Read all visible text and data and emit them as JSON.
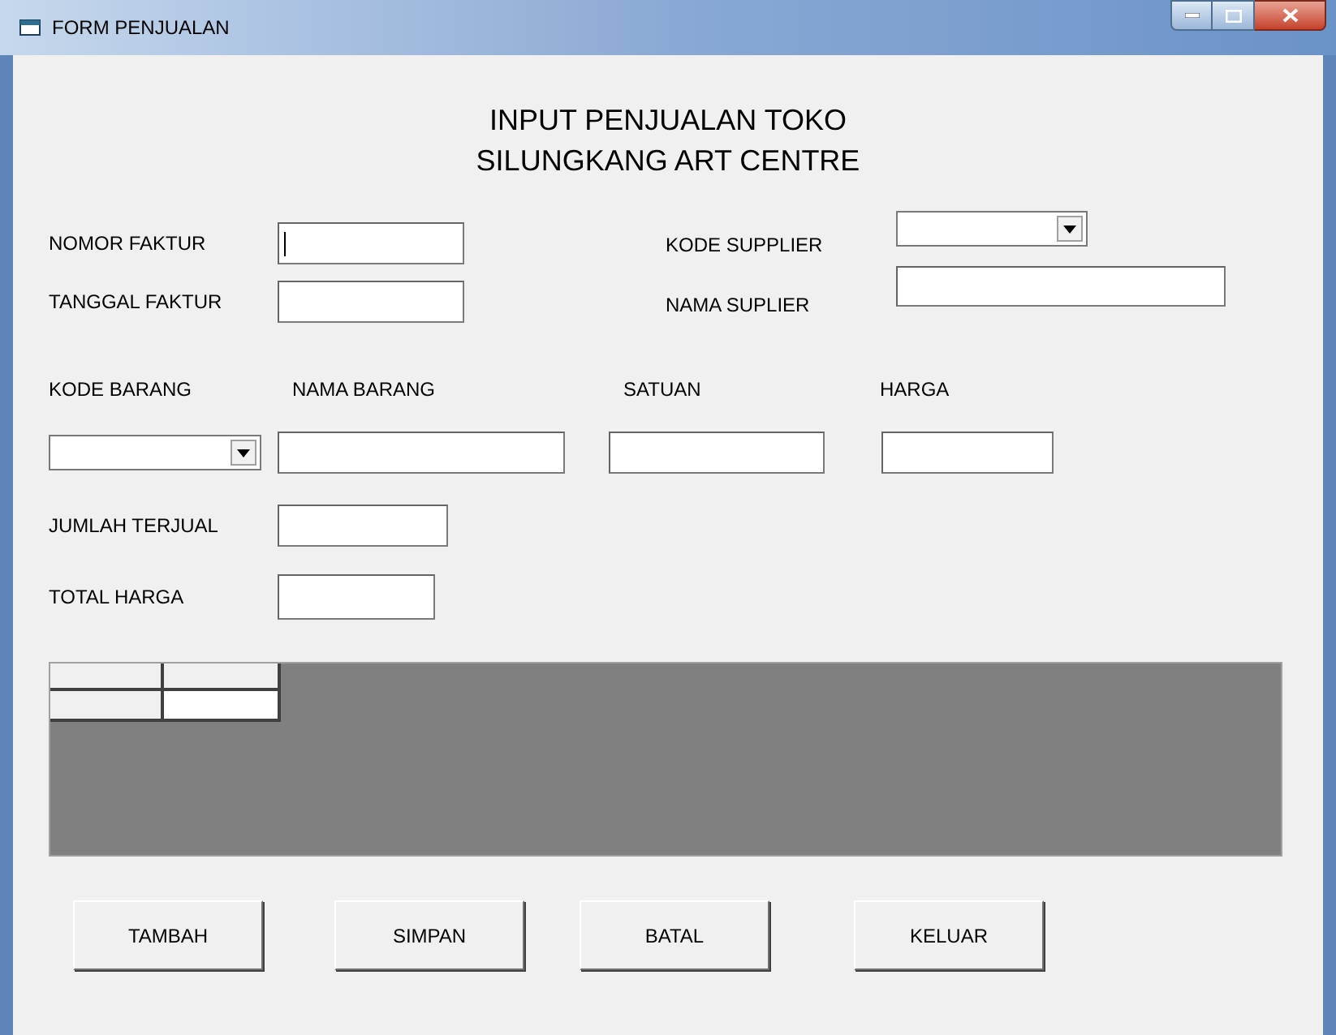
{
  "window": {
    "title": "FORM PENJUALAN"
  },
  "heading": [
    "INPUT PENJUALAN TOKO",
    "SILUNGKANG ART CENTRE"
  ],
  "header_fields": [
    {
      "label": "NOMOR FAKTUR",
      "kind": "text",
      "focused": true
    },
    {
      "label": "KODE SUPPLIER",
      "kind": "combo"
    },
    {
      "label": "TANGGAL FAKTUR",
      "kind": "text"
    },
    {
      "label": "NAMA SUPLIER",
      "kind": "text"
    }
  ],
  "item_fields": [
    {
      "label": "KODE BARANG",
      "kind": "combo"
    },
    {
      "label": "NAMA BARANG",
      "kind": "text"
    },
    {
      "label": "SATUAN",
      "kind": "text"
    },
    {
      "label": "HARGA",
      "kind": "text"
    }
  ],
  "total_fields": [
    {
      "label": "JUMLAH TERJUAL"
    },
    {
      "label": "TOTAL HARGA"
    }
  ],
  "buttons": [
    "TAMBAH",
    "SIMPAN",
    "BATAL",
    "KELUAR"
  ]
}
